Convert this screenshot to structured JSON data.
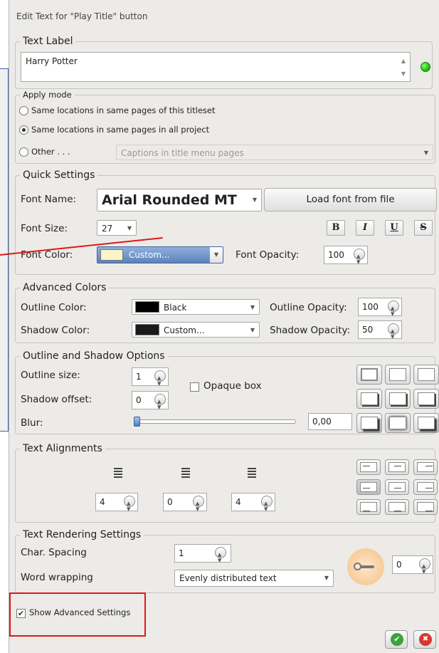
{
  "window": {
    "title": "Edit Text for \"Play Title\" button"
  },
  "text_label": {
    "legend": "Text Label",
    "value": "Harry Potter",
    "status_color": "#19b10b"
  },
  "apply_mode": {
    "legend": "Apply mode",
    "options": [
      {
        "label": "Same locations in same pages of this titleset",
        "selected": false
      },
      {
        "label": "Same locations in same pages in all project",
        "selected": true
      },
      {
        "label": "Other . . .",
        "selected": false
      }
    ],
    "other_combo": "Captions in title menu pages"
  },
  "quick": {
    "legend": "Quick Settings",
    "font_name_label": "Font Name:",
    "font_name_value": "Arial Rounded MT",
    "load_font_button": "Load font from file",
    "font_size_label": "Font Size:",
    "font_size_value": "27",
    "bold": "B",
    "italic": "I",
    "underline": "U",
    "strike": "S",
    "font_color_label": "Font Color:",
    "font_color_value": "Custom...",
    "font_color_swatch": "#fbf4c8",
    "font_opacity_label": "Font Opacity:",
    "font_opacity_value": "100"
  },
  "advanced_colors": {
    "legend": "Advanced Colors",
    "outline_color_label": "Outline Color:",
    "outline_color_value": "Black",
    "outline_swatch": "#000000",
    "outline_opacity_label": "Outline Opacity:",
    "outline_opacity_value": "100",
    "shadow_color_label": "Shadow Color:",
    "shadow_color_value": "Custom...",
    "shadow_swatch": "#1a1a1a",
    "shadow_opacity_label": "Shadow Opacity:",
    "shadow_opacity_value": "50"
  },
  "outline_shadow": {
    "legend": "Outline and Shadow  Options",
    "outline_size_label": "Outline size:",
    "outline_size_value": "1",
    "shadow_offset_label": "Shadow offset:",
    "shadow_offset_value": "0",
    "opaque_box_label": "Opaque box",
    "blur_label": "Blur:",
    "blur_value": "0,00",
    "blur_level": 0
  },
  "alignments": {
    "legend": "Text Alignments",
    "values": [
      "4",
      "0",
      "4"
    ]
  },
  "rendering": {
    "legend": "Text Rendering Settings",
    "char_spacing_label": "Char. Spacing",
    "char_spacing_value": "1",
    "word_wrap_label": "Word wrapping",
    "word_wrap_value": "Evenly distributed text",
    "rotation_value": "0"
  },
  "footer": {
    "show_advanced_label": "Show Advanced Settings"
  }
}
